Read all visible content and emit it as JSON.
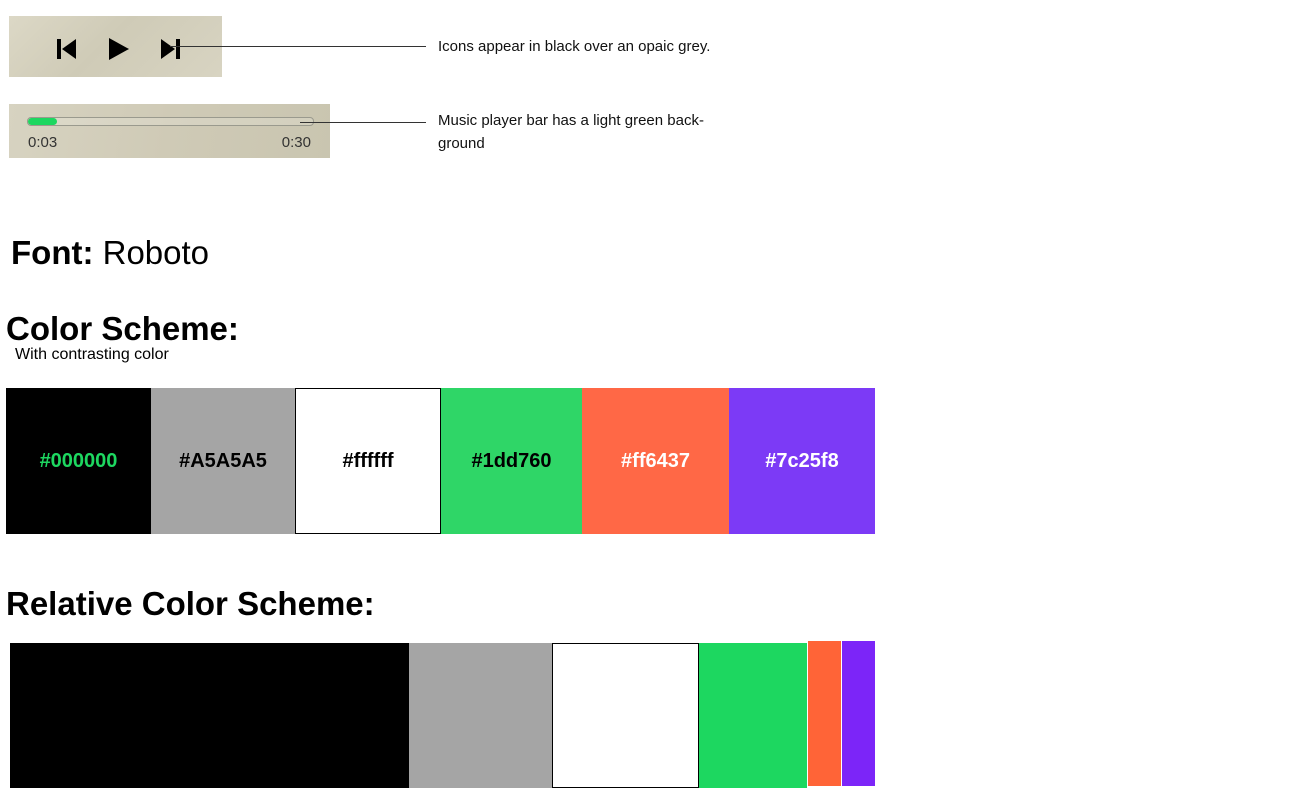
{
  "player": {
    "icons": [
      "skip-previous-icon",
      "play-icon",
      "skip-next-icon"
    ],
    "icon_color": "#000000",
    "progress": {
      "elapsed": "0:03",
      "total": "0:30",
      "fraction": 0.1,
      "fill_color": "#1dd760"
    }
  },
  "annotations": {
    "icons_note": "Icons appear in black over an opaic grey.",
    "bar_note_line1": "Music player bar has a light green back-",
    "bar_note_line2": "ground"
  },
  "font": {
    "label": "Font:",
    "value": "Roboto"
  },
  "color_scheme": {
    "title": "Color Scheme:",
    "subtitle": "With contrasting color",
    "swatches": [
      {
        "label": "#000000",
        "bg": "#000000",
        "text": "#1dd760"
      },
      {
        "label": "#A5A5A5",
        "bg": "#A5A5A5",
        "text": "#000000"
      },
      {
        "label": "#ffffff",
        "bg": "#ffffff",
        "text": "#000000"
      },
      {
        "label": "#1dd760",
        "bg": "#2fd667",
        "text": "#000000"
      },
      {
        "label": "#ff6437",
        "bg": "#ff6846",
        "text": "#ffffff"
      },
      {
        "label": "#7c25f8",
        "bg": "#7c3af6",
        "text": "#ffffff"
      }
    ]
  },
  "relative_color_scheme": {
    "title": "Relative Color Scheme:",
    "colors": [
      "#000000",
      "#A5A5A5",
      "#ffffff",
      "#1dd760",
      "#ff6437",
      "#7c25f8"
    ]
  }
}
